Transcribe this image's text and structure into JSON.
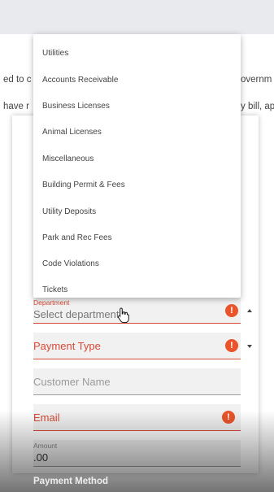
{
  "background": {
    "line1_left": "ed to c",
    "line1_right": "overnm",
    "line2_left": "have r",
    "line2_right": "y bill, ap"
  },
  "dropdown": {
    "options": [
      "Utilities",
      "Accounts Receivable",
      "Business Licenses",
      "Animal Licenses",
      "Miscellaneous",
      "Building Permit & Fees",
      "Utility Deposits",
      "Park and Rec Fees",
      "Code Violations",
      "Tickets"
    ]
  },
  "form": {
    "department_label": "Department",
    "department_placeholder": "Select department",
    "payment_type_placeholder": "Payment Type",
    "customer_name_placeholder": "Customer Name",
    "email_placeholder": "Email",
    "amount_label": "Amount",
    "amount_value": ".00",
    "payment_method_heading": "Payment Method",
    "alert_glyph": "!"
  },
  "colors": {
    "error": "#d84a36",
    "alert": "#e9542a",
    "field_bg": "#f1f1f1",
    "topbar": "#e9eaee"
  }
}
